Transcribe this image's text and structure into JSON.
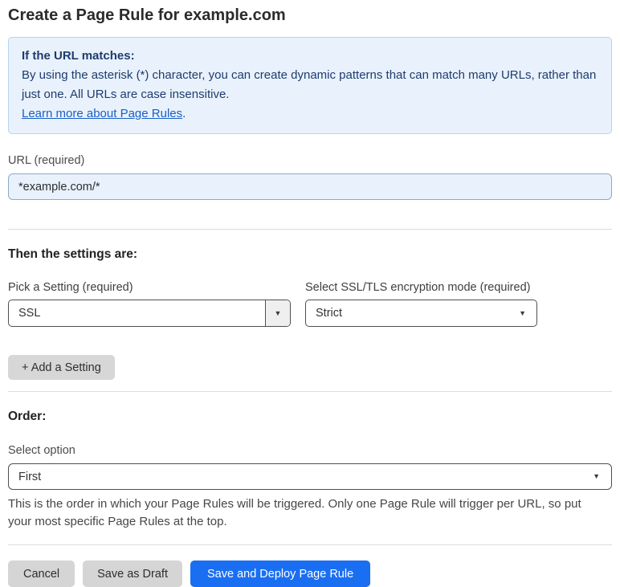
{
  "page": {
    "title": "Create a Page Rule for example.com"
  },
  "info_box": {
    "heading": "If the URL matches:",
    "body": "By using the asterisk (*) character, you can create dynamic patterns that can match many URLs, rather than just one. All URLs are case insensitive.",
    "link_label": "Learn more about Page Rules",
    "link_suffix": "."
  },
  "url_field": {
    "label": "URL (required)",
    "value": "*example.com/*"
  },
  "settings_section": {
    "heading": "Then the settings are:",
    "setting_picker": {
      "label": "Pick a Setting (required)",
      "value": "SSL"
    },
    "ssl_mode_picker": {
      "label": "Select SSL/TLS encryption mode (required)",
      "value": "Strict"
    },
    "add_setting_label": "+ Add a Setting"
  },
  "order_section": {
    "heading": "Order:",
    "select_label": "Select option",
    "value": "First",
    "help_text": "This is the order in which your Page Rules will be triggered. Only one Page Rule will trigger per URL, so put your most specific Page Rules at the top."
  },
  "footer": {
    "cancel_label": "Cancel",
    "save_draft_label": "Save as Draft",
    "save_deploy_label": "Save and Deploy Page Rule"
  },
  "icons": {
    "dropdown_arrow": "▼"
  },
  "colors": {
    "accent_blue": "#1a6ef2",
    "info_background": "#e9f2fc",
    "info_border": "#b5d5f0",
    "info_text": "#1d3c6e",
    "link_blue": "#1a5ec7",
    "input_background": "#e8f1fc"
  }
}
